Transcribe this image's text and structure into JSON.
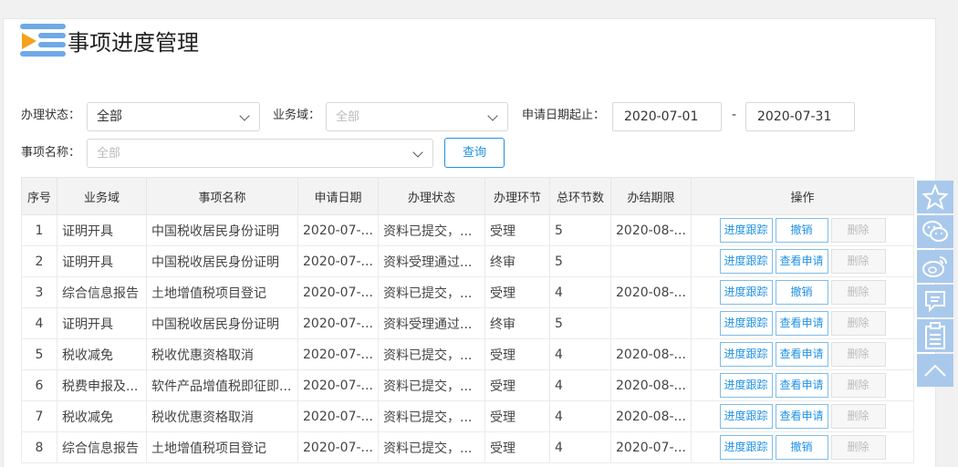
{
  "page": {
    "title": "事项进度管理"
  },
  "filters": {
    "status_label": "办理状态：",
    "status_value": "全部",
    "domain_label": "业务域：",
    "domain_placeholder": "全部",
    "date_label": "申请日期起止：",
    "date_start": "2020-07-01",
    "date_sep": "-",
    "date_end": "2020-07-31",
    "item_label": "事项名称：",
    "item_placeholder": "全部",
    "query_button": "查询"
  },
  "table": {
    "columns": [
      "序号",
      "业务域",
      "事项名称",
      "申请日期",
      "办理状态",
      "办理环节",
      "总环节数",
      "办结期限",
      "操作"
    ],
    "rows": [
      {
        "no": "1",
        "domain": "证明开具",
        "item": "中国税收居民身份证明",
        "date": "2020-07-...",
        "status": "资料已提交，...",
        "stage": "受理",
        "total": "5",
        "deadline": "2020-08-...",
        "btn1": "进度跟踪",
        "btn2": "撤销",
        "btn3": "删除"
      },
      {
        "no": "2",
        "domain": "证明开具",
        "item": "中国税收居民身份证明",
        "date": "2020-07-...",
        "status": "资料受理通过...",
        "stage": "终审",
        "total": "5",
        "deadline": "",
        "btn1": "进度跟踪",
        "btn2": "查看申请",
        "btn3": "删除"
      },
      {
        "no": "3",
        "domain": "综合信息报告",
        "item": "土地增值税项目登记",
        "date": "2020-07-...",
        "status": "资料已提交，...",
        "stage": "受理",
        "total": "4",
        "deadline": "2020-08-...",
        "btn1": "进度跟踪",
        "btn2": "撤销",
        "btn3": "删除"
      },
      {
        "no": "4",
        "domain": "证明开具",
        "item": "中国税收居民身份证明",
        "date": "2020-07-...",
        "status": "资料受理通过...",
        "stage": "终审",
        "total": "5",
        "deadline": "",
        "btn1": "进度跟踪",
        "btn2": "查看申请",
        "btn3": "删除"
      },
      {
        "no": "5",
        "domain": "税收减免",
        "item": "税收优惠资格取消",
        "date": "2020-07-...",
        "status": "资料已提交，...",
        "stage": "受理",
        "total": "4",
        "deadline": "2020-08-...",
        "btn1": "进度跟踪",
        "btn2": "查看申请",
        "btn3": "删除"
      },
      {
        "no": "6",
        "domain": "税费申报及...",
        "item": "软件产品增值税即征即...",
        "date": "2020-07-...",
        "status": "资料已提交，...",
        "stage": "受理",
        "total": "4",
        "deadline": "2020-08-...",
        "btn1": "进度跟踪",
        "btn2": "查看申请",
        "btn3": "删除"
      },
      {
        "no": "7",
        "domain": "税收减免",
        "item": "税收优惠资格取消",
        "date": "2020-07-...",
        "status": "资料已提交，...",
        "stage": "受理",
        "total": "4",
        "deadline": "2020-08-...",
        "btn1": "进度跟踪",
        "btn2": "查看申请",
        "btn3": "删除"
      },
      {
        "no": "8",
        "domain": "综合信息报告",
        "item": "土地增值税项目登记",
        "date": "2020-07-...",
        "status": "资料已提交，...",
        "stage": "受理",
        "total": "4",
        "deadline": "2020-07-...",
        "btn1": "进度跟踪",
        "btn2": "撤销",
        "btn3": "删除"
      }
    ]
  },
  "sidebar": {
    "icons": [
      "star-icon",
      "wechat-icon",
      "weibo-icon",
      "message-icon",
      "clipboard-icon",
      "scroll-top-icon"
    ],
    "color": "#a9c9ec"
  }
}
